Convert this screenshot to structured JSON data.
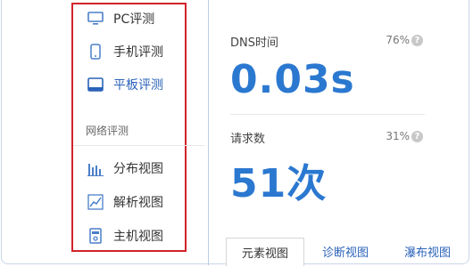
{
  "sidebar": {
    "items_top": [
      {
        "label": "PC评测",
        "icon": "monitor-icon"
      },
      {
        "label": "手机评测",
        "icon": "phone-icon"
      },
      {
        "label": "平板评测",
        "icon": "tablet-icon",
        "active": true
      }
    ],
    "section_label": "网络评测",
    "items_bottom": [
      {
        "label": "分布视图",
        "icon": "distribution-chart-icon"
      },
      {
        "label": "解析视图",
        "icon": "line-chart-icon"
      },
      {
        "label": "主机视图",
        "icon": "host-server-icon"
      }
    ]
  },
  "metrics": [
    {
      "label": "DNS时间",
      "percent": "76%",
      "value": "0.03s"
    },
    {
      "label": "请求数",
      "percent": "31%",
      "value": "51次"
    }
  ],
  "tabs": [
    {
      "label": "元素视图",
      "active": true
    },
    {
      "label": "诊断视图"
    },
    {
      "label": "瀑布视图"
    }
  ],
  "colors": {
    "accent": "#2b78d0",
    "highlight_border": "#d2232a",
    "link": "#2a62b8"
  }
}
